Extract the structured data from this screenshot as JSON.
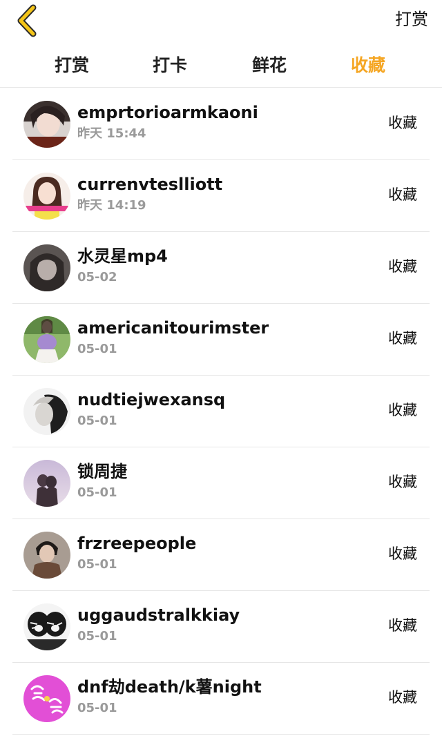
{
  "header": {
    "back_icon": "chevron-left-icon",
    "back_color": "#f5c518",
    "action_label": "打赏"
  },
  "tabs": [
    {
      "label": "打赏",
      "active": false
    },
    {
      "label": "打卡",
      "active": false
    },
    {
      "label": "鲜花",
      "active": false
    },
    {
      "label": "收藏",
      "active": true
    }
  ],
  "accent_color": "#f5a623",
  "records": [
    {
      "name": "emprtorioarmkaoni",
      "time": "昨天 15:44",
      "action": "收藏"
    },
    {
      "name": "currenvteslliott",
      "time": "昨天 14:19",
      "action": "收藏"
    },
    {
      "name": "水灵星mp4",
      "time": "05-02",
      "action": "收藏"
    },
    {
      "name": "americanitourimster",
      "time": "05-01",
      "action": "收藏"
    },
    {
      "name": "nudtiejwexansq",
      "time": "05-01",
      "action": "收藏"
    },
    {
      "name": "锁周捷",
      "time": "05-01",
      "action": "收藏"
    },
    {
      "name": "frzreepeople",
      "time": "05-01",
      "action": "收藏"
    },
    {
      "name": "uggaudstralkkiay",
      "time": "05-01",
      "action": "收藏"
    },
    {
      "name": "dnf劫death/k薯night",
      "time": "05-01",
      "action": "收藏"
    }
  ]
}
